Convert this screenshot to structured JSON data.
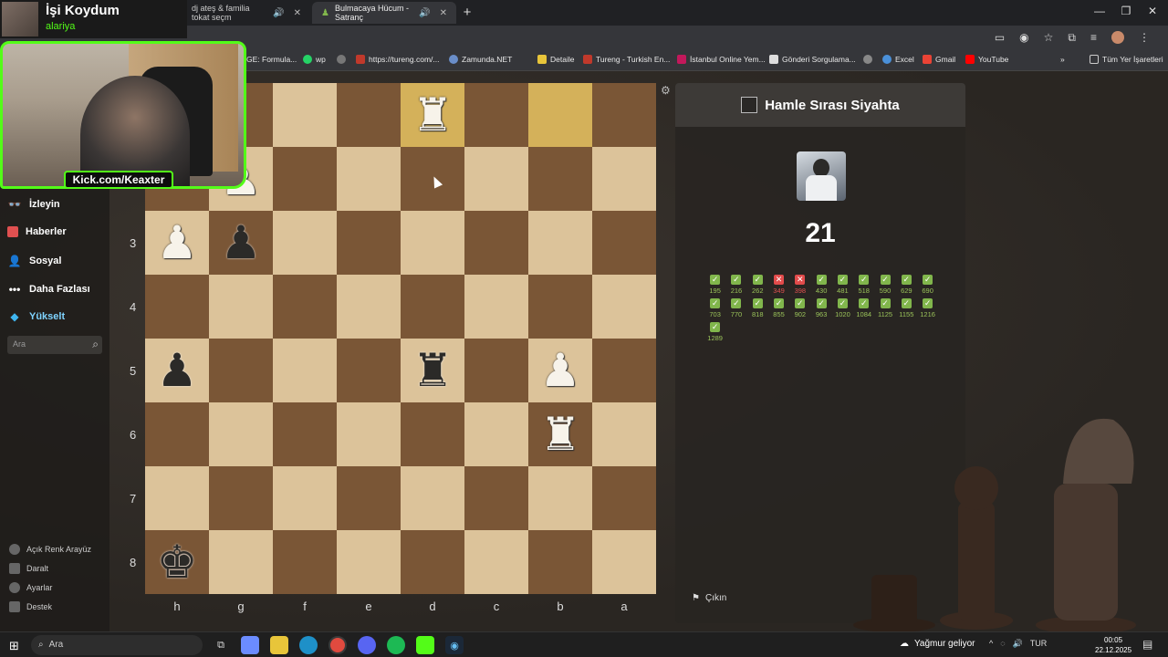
{
  "browser": {
    "tabs": [
      {
        "label": "dj ateş & familia tokat seçm",
        "active": false
      },
      {
        "label": "Bulmacaya Hücum - Satranç",
        "active": true
      }
    ],
    "bookmarks": [
      "GE: Formula...",
      "wp",
      "https://tureng.com/...",
      "Zamunda.NET",
      "Detaile",
      "Tureng - Turkish En...",
      "İstanbul Online Yem...",
      "Gönderi Sorgulama...",
      "Excel",
      "Gmail",
      "YouTube",
      "Tüm Yer İşaretleri"
    ]
  },
  "stream": {
    "title": "İşi Koydum",
    "subtitle": "alariya",
    "kick_label": "Kick.com/Keaxter"
  },
  "sidebar": {
    "items": [
      {
        "label": "İzleyin",
        "icon": "binoculars-icon"
      },
      {
        "label": "Haberler",
        "icon": "news-icon"
      },
      {
        "label": "Sosyal",
        "icon": "people-icon"
      },
      {
        "label": "Daha Fazlası",
        "icon": "more-icon"
      },
      {
        "label": "Yükselt",
        "icon": "diamond-icon"
      }
    ],
    "search_placeholder": "Ara",
    "bottom": [
      {
        "label": "Açık Renk Arayüz"
      },
      {
        "label": "Daralt"
      },
      {
        "label": "Ayarlar"
      },
      {
        "label": "Destek"
      }
    ]
  },
  "board": {
    "ranks": [
      "3",
      "4",
      "5",
      "6",
      "7",
      "8"
    ],
    "files": [
      "h",
      "g",
      "f",
      "e",
      "d",
      "c",
      "b",
      "a"
    ],
    "pieces": [
      {
        "row": 0,
        "col": 4,
        "glyph": "♜",
        "color": "w"
      },
      {
        "row": 1,
        "col": 1,
        "glyph": "♟",
        "color": "w"
      },
      {
        "row": 2,
        "col": 0,
        "glyph": "♟",
        "color": "w"
      },
      {
        "row": 2,
        "col": 1,
        "glyph": "♟",
        "color": "b"
      },
      {
        "row": 4,
        "col": 0,
        "glyph": "♟",
        "color": "b"
      },
      {
        "row": 4,
        "col": 4,
        "glyph": "♜",
        "color": "b"
      },
      {
        "row": 4,
        "col": 6,
        "glyph": "♟",
        "color": "w"
      },
      {
        "row": 5,
        "col": 6,
        "glyph": "♜",
        "color": "w"
      },
      {
        "row": 7,
        "col": 0,
        "glyph": "♚",
        "color": "b"
      }
    ],
    "highlights": [
      {
        "row": 0,
        "col": 4
      },
      {
        "row": 0,
        "col": 6
      }
    ]
  },
  "panel": {
    "turn_text": "Hamle Sırası Siyahta",
    "score": "21",
    "results": [
      {
        "n": "195",
        "ok": true
      },
      {
        "n": "216",
        "ok": true
      },
      {
        "n": "262",
        "ok": true
      },
      {
        "n": "349",
        "ok": false
      },
      {
        "n": "398",
        "ok": false
      },
      {
        "n": "430",
        "ok": true
      },
      {
        "n": "481",
        "ok": true
      },
      {
        "n": "518",
        "ok": true
      },
      {
        "n": "590",
        "ok": true
      },
      {
        "n": "629",
        "ok": true
      },
      {
        "n": "690",
        "ok": true
      },
      {
        "n": "703",
        "ok": true
      },
      {
        "n": "770",
        "ok": true
      },
      {
        "n": "818",
        "ok": true
      },
      {
        "n": "855",
        "ok": true
      },
      {
        "n": "902",
        "ok": true
      },
      {
        "n": "963",
        "ok": true
      },
      {
        "n": "1020",
        "ok": true
      },
      {
        "n": "1084",
        "ok": true
      },
      {
        "n": "1125",
        "ok": true
      },
      {
        "n": "1155",
        "ok": true
      },
      {
        "n": "1216",
        "ok": true
      },
      {
        "n": "1289",
        "ok": true
      }
    ],
    "exit_label": "Çıkın"
  },
  "taskbar": {
    "search_label": "Ara",
    "weather": "Yağmur geliyor",
    "lang": "TUR",
    "time": "00:05",
    "date": "22.12.2025"
  },
  "colors": {
    "accent_green": "#53fc18",
    "ok": "#81b64c",
    "bad": "#e24b4b"
  }
}
